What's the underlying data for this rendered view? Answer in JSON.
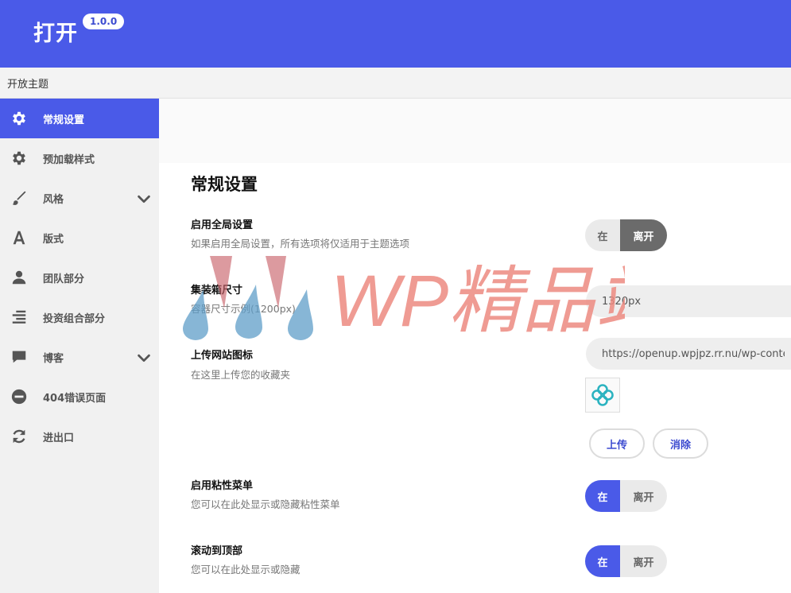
{
  "header": {
    "title": "打开",
    "version": "1.0.0"
  },
  "subbar": {
    "title": "开放主题"
  },
  "sidebar": {
    "items": [
      {
        "label": "常规设置",
        "icon": "gear-icon",
        "active": true
      },
      {
        "label": "预加载样式",
        "icon": "gear-icon"
      },
      {
        "label": "风格",
        "icon": "brush-icon",
        "expandable": true
      },
      {
        "label": "版式",
        "icon": "typography-icon"
      },
      {
        "label": "团队部分",
        "icon": "user-icon"
      },
      {
        "label": "投资组合部分",
        "icon": "align-icon"
      },
      {
        "label": "博客",
        "icon": "comment-icon",
        "expandable": true
      },
      {
        "label": "404错误页面",
        "icon": "minus-circle-icon"
      },
      {
        "label": "进出口",
        "icon": "refresh-icon"
      }
    ]
  },
  "main": {
    "section_title": "常规设置",
    "global": {
      "label": "启用全局设置",
      "desc": "如果启用全局设置，所有选项将仅适用于主题选项",
      "on": "在",
      "off": "离开",
      "state": "off"
    },
    "container": {
      "label": "集装箱尺寸",
      "desc": "容器尺寸示例(1200px)",
      "value": "1320px"
    },
    "favicon": {
      "label": "上传网站图标",
      "desc": "在这里上传您的收藏夹",
      "value": "https://openup.wpjpz.rr.nu/wp-content",
      "upload": "上传",
      "remove": "消除"
    },
    "sticky": {
      "label": "启用粘性菜单",
      "desc": "您可以在此处显示或隐藏粘性菜单",
      "on": "在",
      "off": "离开",
      "state": "on"
    },
    "scrolltop": {
      "label": "滚动到顶部",
      "desc": "您可以在此处显示或隐藏",
      "on": "在",
      "off": "离开",
      "state": "on"
    }
  },
  "watermark": {
    "text": "WP精品站"
  },
  "colors": {
    "accent": "#4a5ae8",
    "toggle_dark": "#6b6b6b",
    "watermark_text": "#ec8a80"
  }
}
